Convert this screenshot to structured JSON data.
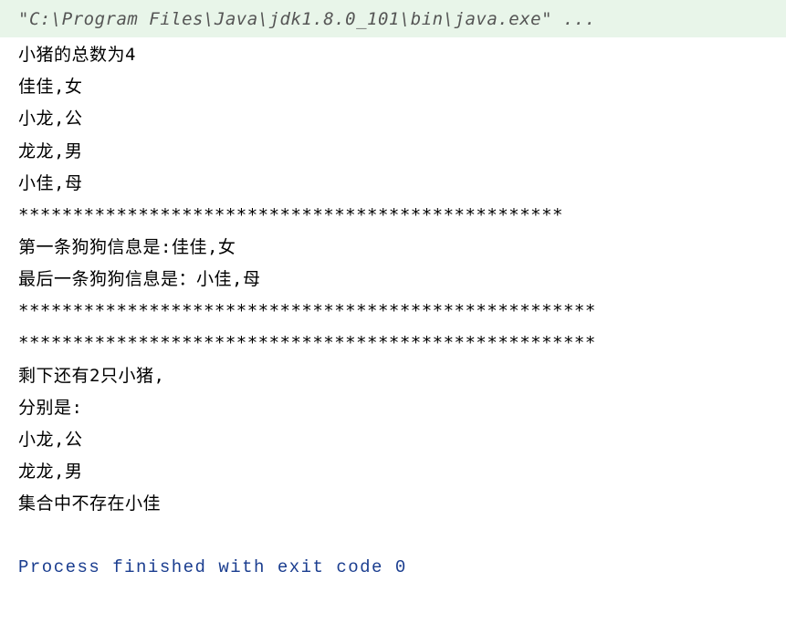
{
  "console": {
    "command": "\"C:\\Program Files\\Java\\jdk1.8.0_101\\bin\\java.exe\" ...",
    "lines": [
      "小猪的总数为4",
      "佳佳,女",
      "小龙,公",
      "龙龙,男",
      "小佳,母",
      "**************************************************",
      "第一条狗狗信息是:佳佳,女",
      "最后一条狗狗信息是：小佳,母",
      "*****************************************************",
      "*****************************************************",
      "剩下还有2只小猪,",
      "分别是:",
      "小龙,公",
      "龙龙,男",
      "集合中不存在小佳"
    ],
    "exit_message": "Process finished with exit code 0"
  }
}
